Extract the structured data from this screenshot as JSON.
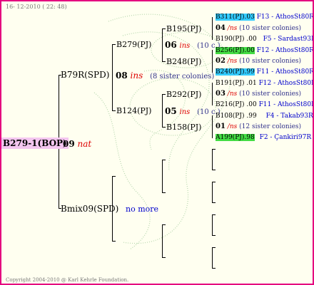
{
  "header": "16- 12-2010 ( 22: 48)",
  "copyright": "Copyright 2004-2010 @ Karl Kehrle Foundation.",
  "root": {
    "label": "B279-1(BOP)",
    "gen": "09",
    "kind": "nat"
  },
  "gen1": [
    {
      "label": "B79R(SPD)",
      "gen": "08",
      "kind": "ins",
      "note": "(8 sister colonies)"
    },
    {
      "label": "Bmix09(SPD)",
      "note": "no more"
    }
  ],
  "gen2": [
    {
      "label": "B279(PJ)",
      "gen": "06",
      "kind": "ins",
      "note": "(10 c.)"
    },
    {
      "label": "B124(PJ)",
      "gen": "05",
      "kind": "ins",
      "note": "(10 c.)"
    }
  ],
  "gen3": [
    {
      "label": "B195(PJ)"
    },
    {
      "label": "B248(PJ)"
    },
    {
      "label": "B292(PJ)"
    },
    {
      "label": "B158(PJ)"
    }
  ],
  "gen4": [
    {
      "label": "B311(PJ)",
      "code": ".03",
      "info": "F13 - AthosSt80R",
      "highlight": "cyan"
    },
    {
      "gen": "04",
      "kind": "/ns",
      "note": "(10 sister colonies)"
    },
    {
      "label": "B190(PJ)",
      "code": ".00",
      "info": "F5 - Sardast93R"
    },
    {
      "label": "B256(PJ)",
      "code": ".00",
      "info": "F12 - AthosSt80R",
      "highlight": "green"
    },
    {
      "gen": "02",
      "kind": "/ns",
      "note": "(10 sister colonies)"
    },
    {
      "label": "B240(PJ)",
      "code": ".99",
      "info": "F11 - AthosSt80R",
      "highlight": "cyan"
    },
    {
      "label": "B191(PJ)",
      "code": ".01",
      "info": "F12 - AthosSt80R"
    },
    {
      "gen": "03",
      "kind": "/ns",
      "note": "(10 sister colonies)"
    },
    {
      "label": "B216(PJ)",
      "code": ".00",
      "info": "F11 - AthosSt80R"
    },
    {
      "label": "B108(PJ)",
      "code": ".99",
      "info": "F4 - Takab93R"
    },
    {
      "gen": "01",
      "kind": "/ns",
      "note": "(12 sister colonies)"
    },
    {
      "label": "A199(PJ)",
      "code": ".98",
      "info": "F2 - Çankiri97R",
      "highlight": "green"
    }
  ],
  "colors": {
    "frame": "#e4007f",
    "root_bg": "#f4c6f0",
    "cyan": "#33ccff",
    "green": "#44dd44",
    "red": "#dd0000",
    "blue": "#0000cc"
  }
}
